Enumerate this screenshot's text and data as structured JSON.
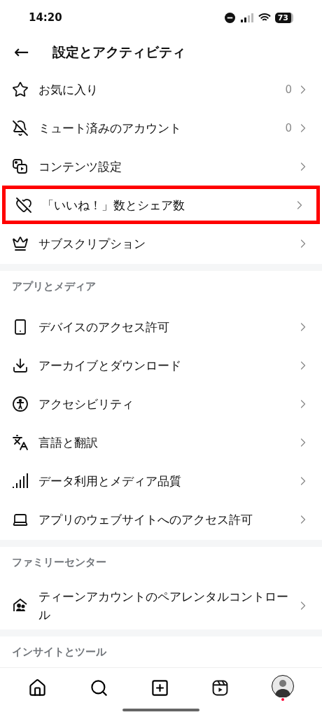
{
  "status_bar": {
    "time": "14:20",
    "battery": "73"
  },
  "header": {
    "back": "←",
    "title": "設定とアクティビティ"
  },
  "sections": [
    {
      "items": [
        {
          "label": "お気に入り",
          "count": "0",
          "highlighted": false
        },
        {
          "label": "ミュート済みのアカウント",
          "count": "0",
          "highlighted": false
        },
        {
          "label": "コンテンツ設定",
          "highlighted": false
        },
        {
          "label": "「いいね！」数とシェア数",
          "highlighted": true
        },
        {
          "label": "サブスクリプション",
          "highlighted": false
        }
      ]
    },
    {
      "header": "アプリとメディア",
      "items": [
        {
          "label": "デバイスのアクセス許可",
          "highlighted": false
        },
        {
          "label": "アーカイブとダウンロード",
          "highlighted": false
        },
        {
          "label": "アクセシビリティ",
          "highlighted": false
        },
        {
          "label": "言語と翻訳",
          "highlighted": false
        },
        {
          "label": "データ利用とメディア品質",
          "highlighted": false
        },
        {
          "label": "アプリのウェブサイトへのアクセス許可",
          "highlighted": false
        }
      ]
    },
    {
      "header": "ファミリーセンター",
      "items": [
        {
          "label": "ティーンアカウントのペアレンタルコントロール",
          "highlighted": false
        }
      ]
    },
    {
      "header": "インサイトとツール"
    }
  ],
  "bottom_nav": {
    "profile_notification": true
  }
}
